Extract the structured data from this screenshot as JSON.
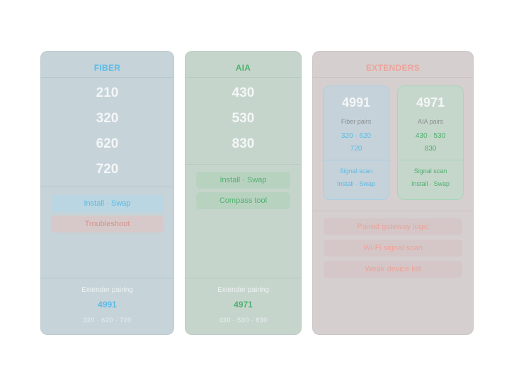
{
  "page": {
    "title": ""
  },
  "colors": {
    "fiber": "#5bbbe6",
    "aia": "#4fb06f",
    "extenders": "#eca39b"
  },
  "fiber": {
    "header": "FIBER",
    "models": [
      "210",
      "320",
      "620",
      "720"
    ],
    "buttons": [
      "Install · Swap",
      "Troubleshoot"
    ],
    "footer": {
      "label": "Extender pairing",
      "code": "4991",
      "list": "320 · 620 · 720"
    }
  },
  "aia": {
    "header": "AIA",
    "models": [
      "430",
      "530",
      "830"
    ],
    "buttons": [
      "Install · Swap",
      "Compass tool"
    ],
    "footer": {
      "label": "Extender pairing",
      "code": "4971",
      "list": "430 · 530 · 830"
    }
  },
  "extenders": {
    "header": "EXTENDERS",
    "cards": [
      {
        "code": "4991",
        "label": "Fiber pairs",
        "nums_line1": "320 · 620",
        "nums_line2": "720",
        "links": [
          "Signal scan",
          "Install · Swap"
        ]
      },
      {
        "code": "4971",
        "label": "AIA pairs",
        "nums_line1": "430 · 530",
        "nums_line2": "830",
        "links": [
          "Signal scan",
          "Install · Swap"
        ]
      }
    ],
    "buttons": [
      "Paired gateway logic",
      "Wi-Fi signal scan",
      "Weak device list"
    ]
  }
}
